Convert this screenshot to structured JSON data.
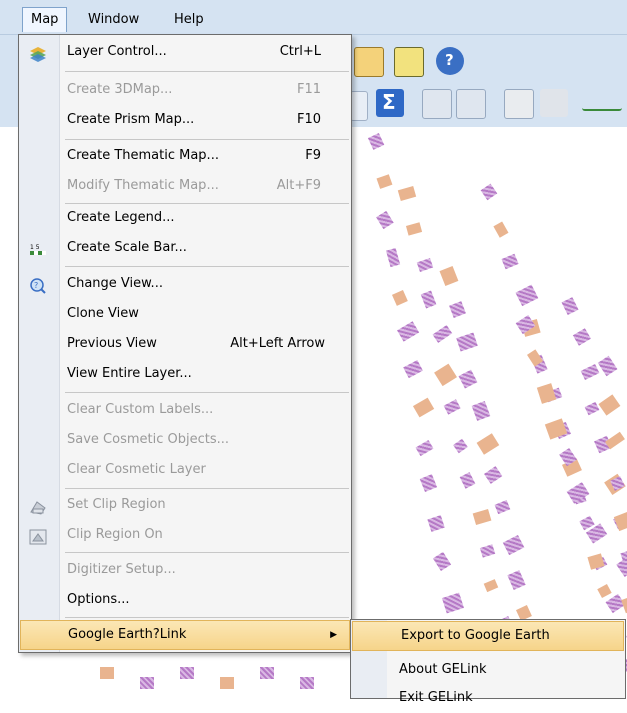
{
  "menubar": {
    "items": [
      {
        "label": "Map",
        "active": true
      },
      {
        "label": "Window",
        "active": false
      },
      {
        "label": "Help",
        "active": false
      }
    ]
  },
  "map_menu": {
    "items": [
      {
        "label": "Layer Control...",
        "shortcut": "Ctrl+L",
        "disabled": false,
        "icon": "layer-control-icon"
      },
      {
        "label": "Create 3DMap...",
        "shortcut": "F11",
        "disabled": true
      },
      {
        "label": "Create Prism Map...",
        "shortcut": "F10",
        "disabled": false
      },
      {
        "label": "Create Thematic Map...",
        "shortcut": "F9",
        "disabled": false
      },
      {
        "label": "Modify Thematic Map...",
        "shortcut": "Alt+F9",
        "disabled": true
      },
      {
        "label": "Create Legend...",
        "shortcut": "",
        "disabled": false
      },
      {
        "label": "Create Scale Bar...",
        "shortcut": "",
        "disabled": false,
        "icon": "scale-bar-icon"
      },
      {
        "label": "Change View...",
        "shortcut": "",
        "disabled": false,
        "icon": "change-view-icon"
      },
      {
        "label": "Clone View",
        "shortcut": "",
        "disabled": false
      },
      {
        "label": "Previous View",
        "shortcut": "Alt+Left Arrow",
        "disabled": false
      },
      {
        "label": "View Entire Layer...",
        "shortcut": "",
        "disabled": false
      },
      {
        "label": "Clear Custom Labels...",
        "shortcut": "",
        "disabled": true
      },
      {
        "label": "Save Cosmetic Objects...",
        "shortcut": "",
        "disabled": true
      },
      {
        "label": "Clear Cosmetic Layer",
        "shortcut": "",
        "disabled": true
      },
      {
        "label": "Set Clip Region",
        "shortcut": "",
        "disabled": true,
        "icon": "set-clip-region-icon"
      },
      {
        "label": "Clip Region On",
        "shortcut": "",
        "disabled": true,
        "icon": "clip-region-on-icon"
      },
      {
        "label": "Digitizer Setup...",
        "shortcut": "",
        "disabled": true
      },
      {
        "label": "Options...",
        "shortcut": "",
        "disabled": false
      },
      {
        "label": "Google Earth?Link",
        "shortcut": "",
        "disabled": false,
        "submenu": true,
        "highlighted": true
      }
    ]
  },
  "submenu": {
    "items": [
      {
        "label": "Export to Google Earth",
        "highlighted": true
      },
      {
        "label": "About GELink",
        "highlighted": false
      },
      {
        "label": "Exit GELink",
        "highlighted": false
      }
    ]
  },
  "colors": {
    "menubar_bg": "#d5e3f2",
    "highlight": "#f6d48a",
    "parcel_purple": "#b579c6",
    "parcel_tan": "#e9b48f"
  }
}
